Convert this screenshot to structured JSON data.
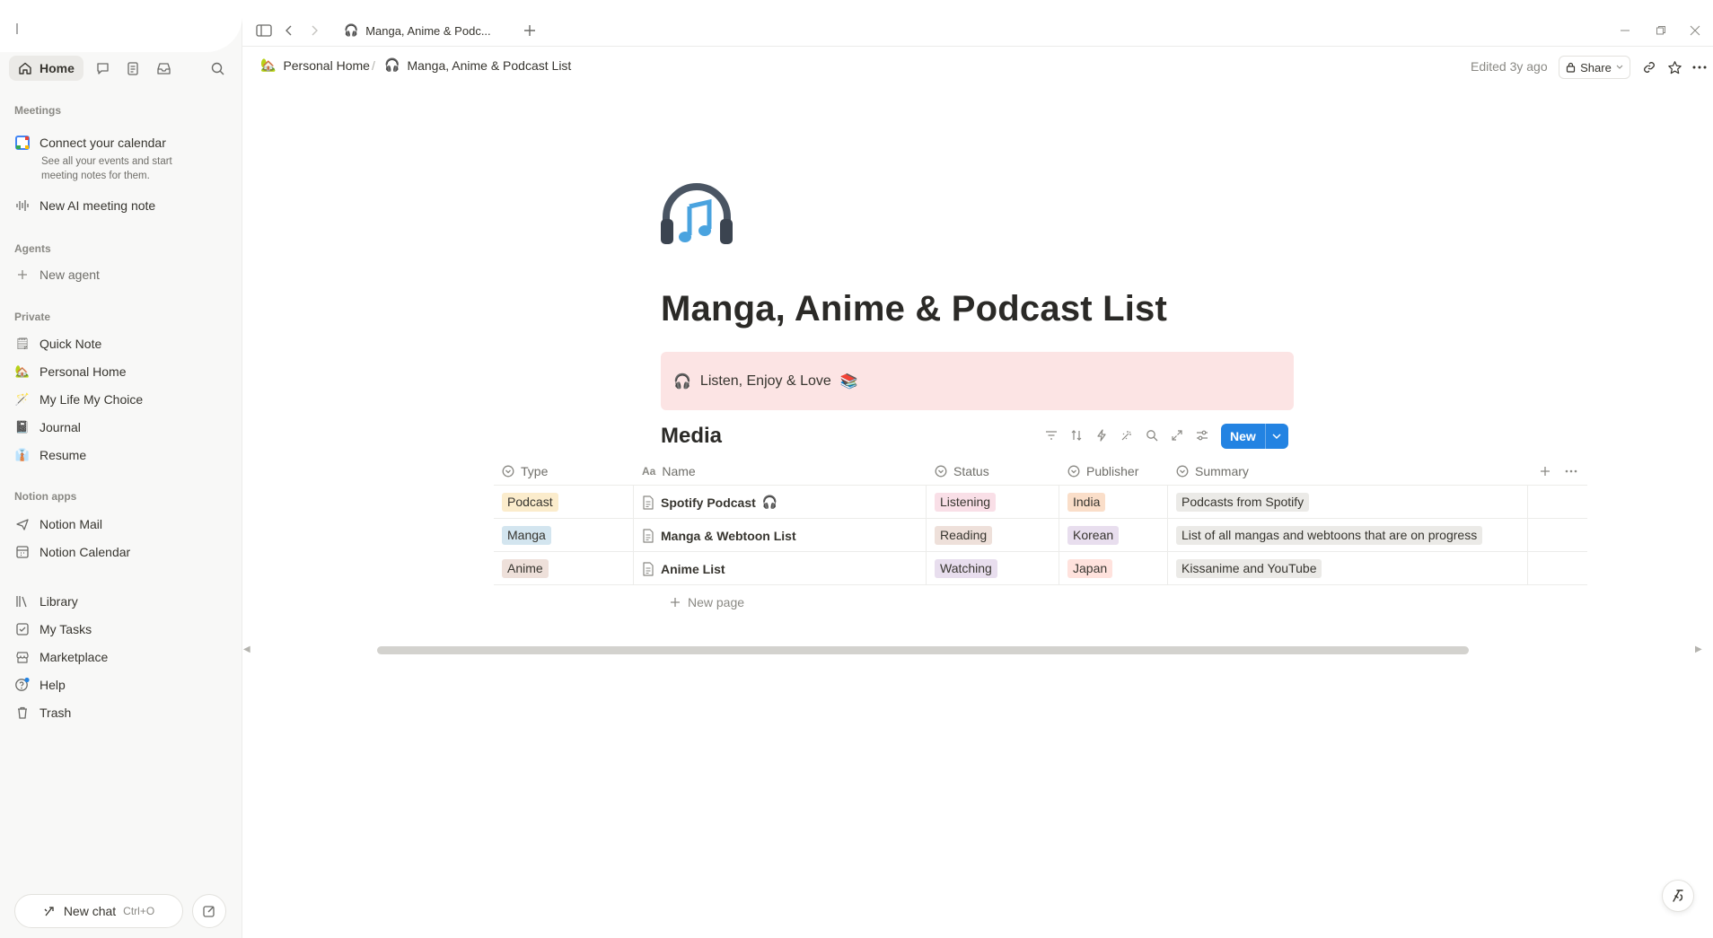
{
  "tab": {
    "title": "Manga, Anime & Podc..."
  },
  "sidebar": {
    "home_label": "Home",
    "meetings_heading": "Meetings",
    "connect_calendar": {
      "title": "Connect your calendar",
      "subtitle": "See all your events and start meeting notes for them."
    },
    "new_ai_meeting": "New AI meeting note",
    "agents_heading": "Agents",
    "new_agent": "New agent",
    "private_heading": "Private",
    "private_items": [
      {
        "label": "Quick Note",
        "icon": "🗒"
      },
      {
        "label": "Personal Home",
        "icon": "🏡"
      },
      {
        "label": "My Life My Choice",
        "icon": "🪄"
      },
      {
        "label": "Journal",
        "icon": "📓"
      },
      {
        "label": "Resume",
        "icon": "👔"
      }
    ],
    "apps_heading": "Notion apps",
    "apps": [
      {
        "label": "Notion Mail",
        "icon": "mail-icon"
      },
      {
        "label": "Notion Calendar",
        "icon": "calendar-icon"
      }
    ],
    "bottom_items": [
      {
        "label": "Library",
        "icon": "library-icon"
      },
      {
        "label": "My Tasks",
        "icon": "checkbox-icon"
      },
      {
        "label": "Marketplace",
        "icon": "marketplace-icon"
      },
      {
        "label": "Help",
        "icon": "help-icon"
      },
      {
        "label": "Trash",
        "icon": "trash-icon"
      }
    ],
    "new_chat": {
      "label": "New chat",
      "shortcut": "Ctrl+O"
    }
  },
  "header": {
    "breadcrumb": [
      {
        "label": "Personal Home",
        "icon": "🏡"
      },
      {
        "label": "Manga, Anime & Podcast List",
        "icon": "🎧"
      }
    ],
    "edited": "Edited 3y ago",
    "share_label": "Share"
  },
  "page": {
    "title": "Manga, Anime & Podcast List",
    "callout_icon": "🎧",
    "callout_text": "Listen, Enjoy & Love",
    "callout_emoji": "📚"
  },
  "database": {
    "title": "Media",
    "new_label": "New",
    "columns": [
      "Type",
      "Name",
      "Status",
      "Publisher",
      "Summary"
    ],
    "rows": [
      {
        "type": "Podcast",
        "type_color": "#fbeccc",
        "name": "Spotify Podcast",
        "name_emoji": "🎧",
        "status": "Listening",
        "status_color": "#f9dfe7",
        "publisher": "India",
        "publisher_color": "#fadec9",
        "summary": "Podcasts from Spotify"
      },
      {
        "type": "Manga",
        "type_color": "#d3e5ef",
        "name": "Manga & Webtoon List",
        "name_emoji": "",
        "status": "Reading",
        "status_color": "#eee0da",
        "publisher": "Korean",
        "publisher_color": "#e8deee",
        "summary": "List of all mangas and webtoons that are on progress"
      },
      {
        "type": "Anime",
        "type_color": "#eee0da",
        "name": "Anime List",
        "name_emoji": "",
        "status": "Watching",
        "status_color": "#e8deee",
        "publisher": "Japan",
        "publisher_color": "#ffe2dd",
        "summary": "Kissanime and YouTube"
      }
    ],
    "new_page_label": "New page"
  },
  "colors": {
    "accent": "#2383e2",
    "callout_bg": "#fce4e4",
    "summary_tag": "#ebeae7"
  }
}
